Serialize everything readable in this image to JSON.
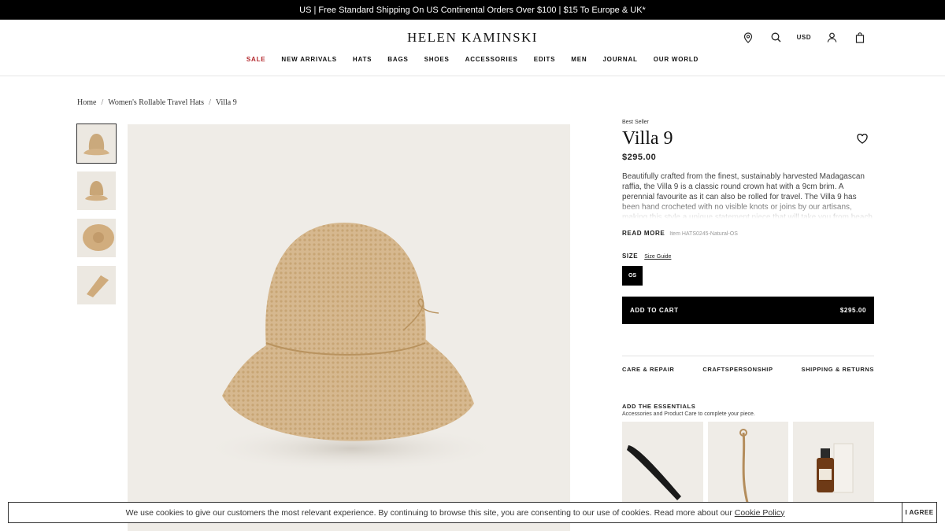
{
  "promo": {
    "text": "US | Free Standard Shipping On US Continental Orders Over $100 | $15 To Europe & UK*"
  },
  "header": {
    "logo": "HELEN KAMINSKI",
    "currency": "USD",
    "icons": [
      "location-pin-icon",
      "search-icon",
      "account-icon",
      "bag-icon"
    ]
  },
  "nav": {
    "items": [
      {
        "label": "SALE"
      },
      {
        "label": "NEW ARRIVALS"
      },
      {
        "label": "HATS"
      },
      {
        "label": "BAGS"
      },
      {
        "label": "SHOES"
      },
      {
        "label": "ACCESSORIES"
      },
      {
        "label": "EDITS"
      },
      {
        "label": "MEN"
      },
      {
        "label": "JOURNAL"
      },
      {
        "label": "OUR WORLD"
      }
    ],
    "sale_color": "#b3282d"
  },
  "breadcrumb": {
    "items": [
      "Home",
      "Women's Rollable Travel Hats",
      "Villa 9"
    ],
    "separator": "/"
  },
  "product": {
    "badge": "Best Seller",
    "title": "Villa 9",
    "price": "$295.00",
    "description": "Beautifully crafted from the finest, sustainably harvested Madagascan raffia, the Villa 9 is a classic round crown hat with a 9cm brim. A perennial favourite as it can also be rolled for travel. The Villa 9 has been hand crocheted with no visible knots or joins by our artisans, making this style a unique statement piece that will take you from beach to city in style.",
    "read_more": "READ MORE",
    "item_code": "Item HATS0245-Natural-OS",
    "size_label": "SIZE",
    "size_guide": "Size Guide",
    "size_option": "OS",
    "add_to_cart": "ADD TO CART",
    "cart_price": "$295.00"
  },
  "tabs": [
    "CARE & REPAIR",
    "CRAFTSPERSONSHIP",
    "SHIPPING & RETURNS"
  ],
  "essentials": {
    "title": "ADD THE ESSENTIALS",
    "subtitle": "Accessories and Product Care to complete your piece."
  },
  "cookie": {
    "text": "We use cookies to give our customers the most relevant experience. By continuing to browse this site, you are consenting to our use of cookies. Read more about our",
    "link": "Cookie Policy",
    "agree": "I AGREE"
  }
}
